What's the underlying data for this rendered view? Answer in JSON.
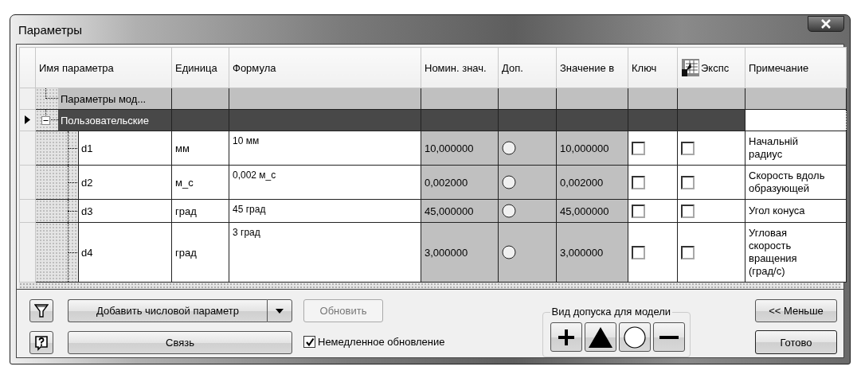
{
  "window": {
    "title": "Параметры"
  },
  "table": {
    "columns": [
      "Имя параметра",
      "Единица",
      "Формула",
      "Номин. знач.",
      "Доп.",
      "Значение в",
      "Ключ",
      "Экспс",
      "Примечание"
    ],
    "groups": [
      {
        "name": "Параметры мод...",
        "selected": false
      },
      {
        "name": "Пользовательские",
        "selected": true,
        "expanded": true,
        "children": [
          {
            "name": "d1",
            "unit": "мм",
            "formula": "10 мм",
            "nominal": "10,000000",
            "value": "10,000000",
            "key": false,
            "export": false,
            "note": "Начальній радиус",
            "selected": false
          },
          {
            "name": "d2",
            "unit": "м_с",
            "formula": "0,002 м_с",
            "nominal": "0,002000",
            "value": "0,002000",
            "key": false,
            "export": false,
            "note": "Скорость вдоль образующей",
            "selected": false
          },
          {
            "name": "d3",
            "unit": "град",
            "formula": "45 град",
            "nominal": "45,000000",
            "value": "45,000000",
            "key": false,
            "export": false,
            "note": "Угол конуса",
            "selected": false
          },
          {
            "name": "d4",
            "unit": "град",
            "formula": "3 град",
            "nominal": "3,000000",
            "value": "3,000000",
            "key": false,
            "export": false,
            "note": "Угловая скорость вращения (град/с)",
            "selected": false
          }
        ]
      }
    ]
  },
  "actions": {
    "add": "Добавить числовой параметр",
    "update": {
      "label": "Обновить",
      "disabled": true
    },
    "link": "Связь",
    "immediate": {
      "label": "Немедленное обновление",
      "checked": true
    },
    "tolerance_label": "Вид допуска для модели",
    "less": "<< Меньше",
    "done": "Готово"
  }
}
